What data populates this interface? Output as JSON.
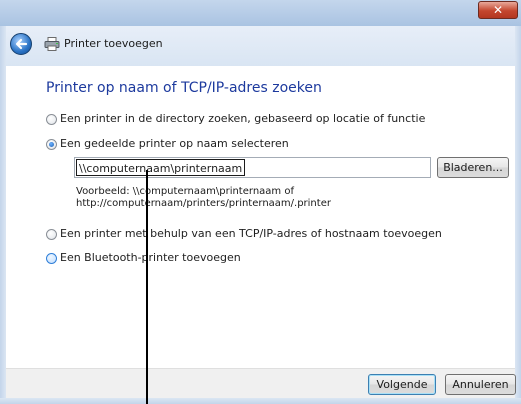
{
  "window": {
    "close_icon": "close-icon",
    "back_icon": "back-arrow-icon",
    "printer_icon": "printer-icon",
    "title": "Printer toevoegen"
  },
  "main": {
    "heading": "Printer op naam of TCP/IP-adres zoeken",
    "options": [
      {
        "label": "Een printer in de directory zoeken, gebaseerd op locatie of functie",
        "selected": false
      },
      {
        "label": "Een gedeelde printer op naam selecteren",
        "selected": true
      },
      {
        "label": "Een printer met behulp van een TCP/IP-adres of hostnaam toevoegen",
        "selected": false
      },
      {
        "label": "Een Bluetooth-printer toevoegen",
        "selected": false
      }
    ],
    "printer_name_value": "\\\\computernaam\\printernaam",
    "browse_label": "Bladeren...",
    "example_line1": "Voorbeeld: \\\\computernaam\\printernaam of",
    "example_line2": "http://computernaam/printers/printernaam/.printer"
  },
  "footer": {
    "next_label": "Volgende",
    "cancel_label": "Annuleren"
  },
  "colors": {
    "heading": "#1d3a9e",
    "title_bar": "#a9c3e2",
    "close_button": "#c4462e"
  }
}
